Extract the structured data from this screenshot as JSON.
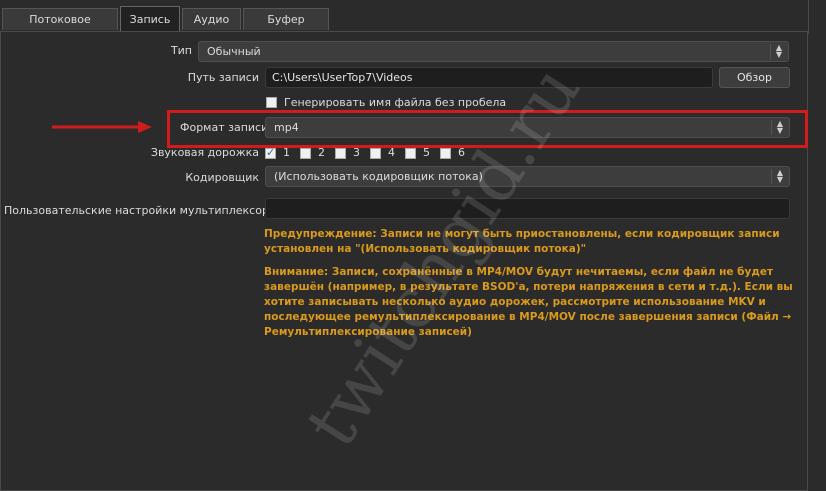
{
  "tabs": [
    {
      "label": "Потоковое вещание",
      "active": false
    },
    {
      "label": "Запись",
      "active": true
    },
    {
      "label": "Аудио",
      "active": false
    },
    {
      "label": "Буфер повтора",
      "active": false
    }
  ],
  "settings": {
    "type": {
      "label": "Тип",
      "value": "Обычный"
    },
    "path": {
      "label": "Путь записи",
      "value": "C:\\Users\\UserTop7\\Videos",
      "browse_label": "Обзор"
    },
    "no_space": {
      "label": "Генерировать имя файла без пробела",
      "checked": false
    },
    "format": {
      "label": "Формат записи",
      "value": "mp4"
    },
    "audio_track": {
      "label": "Звуковая дорожка",
      "tracks": [
        {
          "label": "1",
          "checked": true
        },
        {
          "label": "2",
          "checked": false
        },
        {
          "label": "3",
          "checked": false
        },
        {
          "label": "4",
          "checked": false
        },
        {
          "label": "5",
          "checked": false
        },
        {
          "label": "6",
          "checked": false
        }
      ]
    },
    "encoder": {
      "label": "Кодировщик",
      "value": "(Использовать кодировщик потока)"
    },
    "muxer": {
      "label": "Пользовательские настройки мультиплексора",
      "value": ""
    }
  },
  "warnings": {
    "warning1": "Предупреждение: Записи не могут быть приостановлены, если кодировщик записи установлен на \"(Использовать кодировщик потока)\"",
    "warning2": "Внимание: Записи, сохранённые в MP4/MOV будут нечитаемы, если файл не будет завершён (например, в результате BSOD'а, потери напряжения в сети и т.д.). Если вы хотите записывать несколько аудио дорожек, рассмотрите использование MKV и последующее ремультиплексирование в MP4/MOV после завершения записи (Файл → Ремультиплексирование записей)"
  },
  "watermark": "twitchgid.ru",
  "colors": {
    "highlight": "#d01c1c",
    "warning_text": "#d99a1e",
    "background": "#2b2b2b"
  }
}
